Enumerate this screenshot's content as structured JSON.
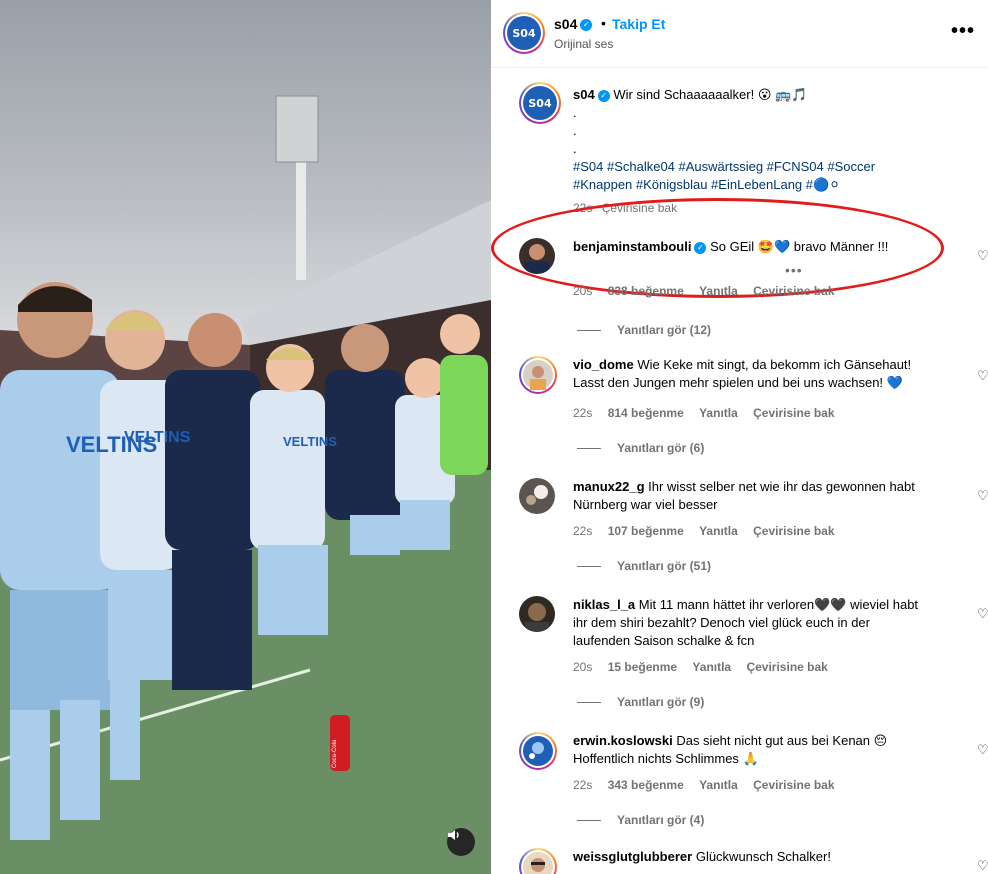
{
  "header": {
    "username": "s04",
    "separator": "•",
    "follow_label": "Takip Et",
    "audio_label": "Orijinal ses",
    "more_label": "•••"
  },
  "caption": {
    "username": "s04",
    "text": "Wir sind Schaaaaaalker! 😮 🚌🎵",
    "dot1": ".",
    "dot2": ".",
    "dot3": ".",
    "hashtags_line1": "#S04 #Schalke04 #Auswärtssieg #FCNS04 #Soccer",
    "hashtags_line2": "#Knappen #Königsblau #EinLebenLang #🔵⚪",
    "time": "22s",
    "translate": "Çevirisine bak"
  },
  "comments": [
    {
      "username": "benjaminstambouli",
      "verified": true,
      "text": "So GEil 🤩💙 bravo Männer !!!",
      "time": "20s",
      "likes": "838 beğenme",
      "reply": "Yanıtla",
      "translate": "Çevirisine bak",
      "more": "•••",
      "replies": "Yanıtları gör (12)"
    },
    {
      "username": "vio_dome",
      "verified": false,
      "text": "Wie Keke mit singt, da bekomm ich Gänsehaut! Lasst den Jungen mehr spielen und bei uns wachsen! 💙",
      "time": "22s",
      "likes": "814 beğenme",
      "reply": "Yanıtla",
      "translate": "Çevirisine bak",
      "replies": "Yanıtları gör (6)"
    },
    {
      "username": "manux22_g",
      "verified": false,
      "text": "Ihr wisst selber net wie ihr das gewonnen habt Nürnberg war viel besser",
      "time": "22s",
      "likes": "107 beğenme",
      "reply": "Yanıtla",
      "translate": "Çevirisine bak",
      "replies": "Yanıtları gör (51)"
    },
    {
      "username": "niklas_l_a",
      "verified": false,
      "text": "Mit 11 mann hättet ihr verloren🖤🖤 wieviel habt ihr dem shiri bezahlt? Denoch viel glück euch in der laufenden Saison schalke & fcn",
      "time": "20s",
      "likes": "15 beğenme",
      "reply": "Yanıtla",
      "translate": "Çevirisine bak",
      "replies": "Yanıtları gör (9)"
    },
    {
      "username": "erwin.koslowski",
      "verified": false,
      "text": "Das sieht nicht gut aus bei Kenan 😔 Hoffentlich nichts Schlimmes 🙏",
      "time": "22s",
      "likes": "343 beğenme",
      "reply": "Yanıtla",
      "translate": "Çevirisine bak",
      "replies": "Yanıtları gör (4)"
    },
    {
      "username": "weissglutglubberer",
      "verified": false,
      "text": "Glückwunsch Schalker!"
    }
  ],
  "media": {
    "sponsor_text": "VELTINS",
    "bottle_text": "Coca-Cola",
    "mute_icon": "speaker-icon"
  },
  "colors": {
    "accent": "#0095f6",
    "highlight": "#e21b1b",
    "shirt": "#a9cdea",
    "navy": "#1b2a4a"
  }
}
